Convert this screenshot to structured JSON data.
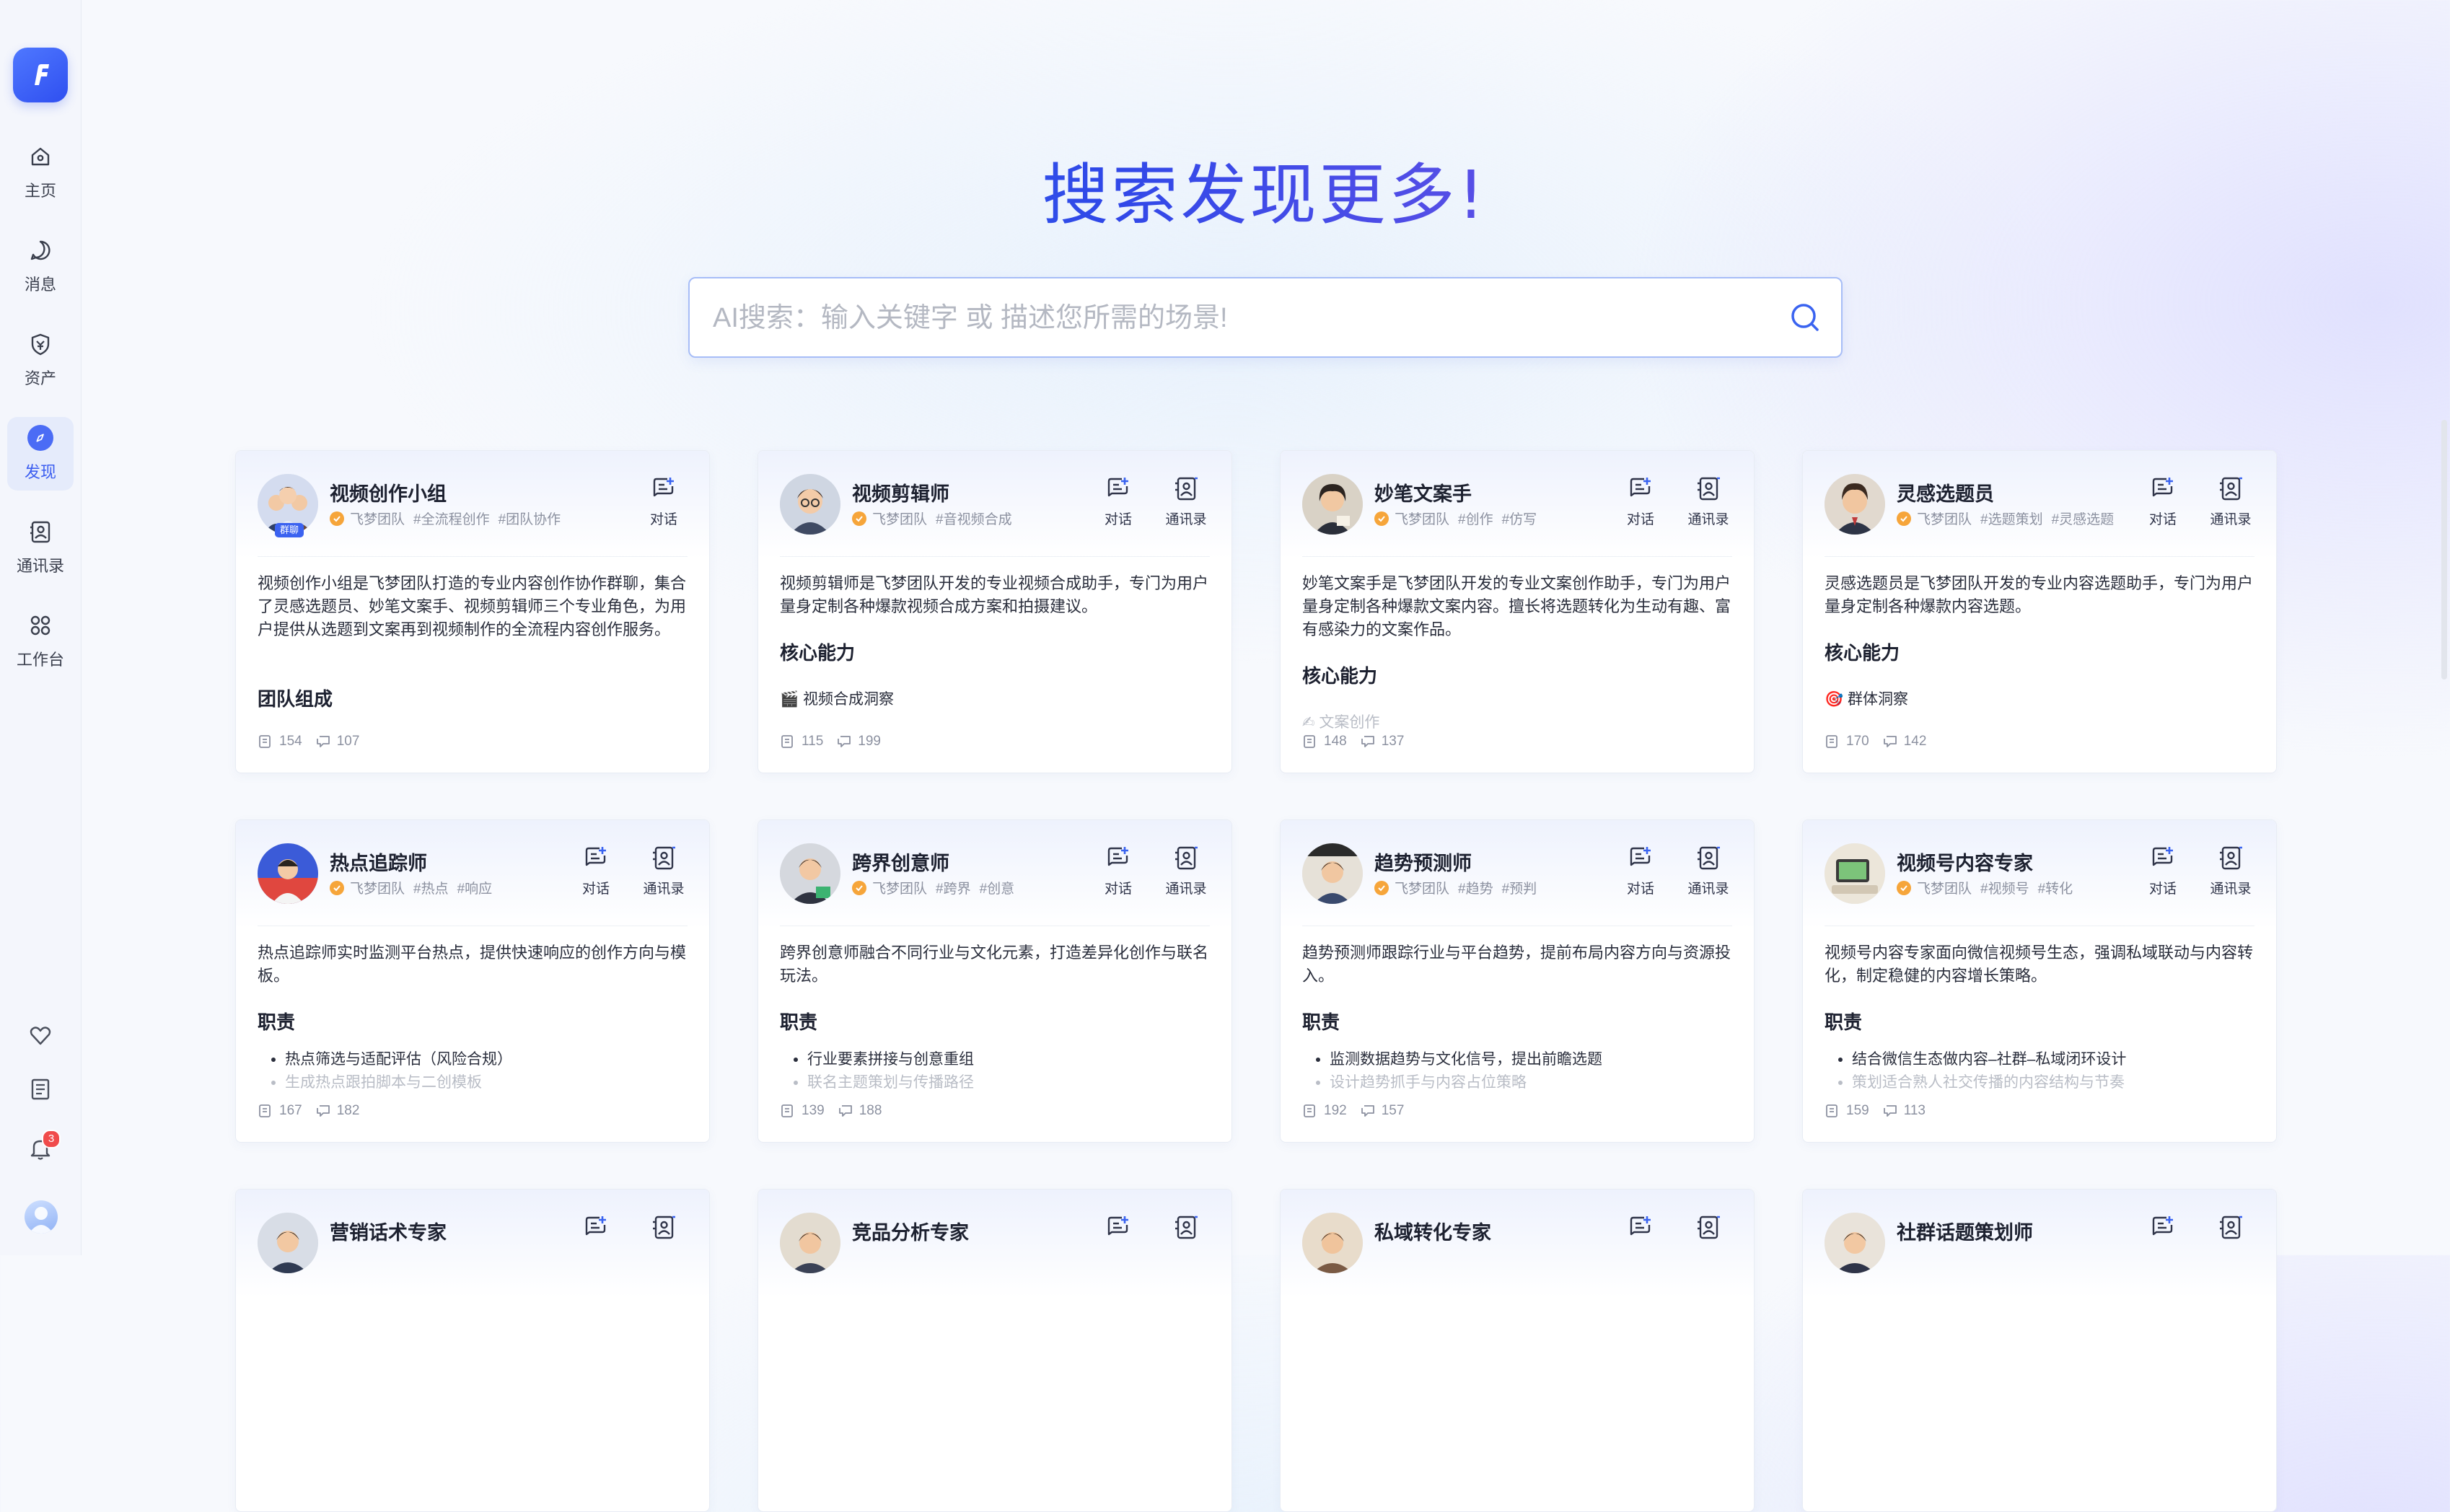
{
  "sidebar": {
    "logo_letter": "F",
    "nav": [
      {
        "label": "主页",
        "icon": "home-icon"
      },
      {
        "label": "消息",
        "icon": "message-icon"
      },
      {
        "label": "资产",
        "icon": "assets-icon"
      },
      {
        "label": "发现",
        "icon": "discover-icon",
        "active": true
      },
      {
        "label": "通讯录",
        "icon": "contacts-icon"
      },
      {
        "label": "工作台",
        "icon": "workbench-icon"
      }
    ],
    "notification_count": "3"
  },
  "hero": {
    "title": "搜索发现更多!"
  },
  "search": {
    "placeholder": "AI搜索：输入关键字 或 描述您所需的场景!",
    "value": ""
  },
  "common": {
    "chat_label": "对话",
    "contacts_label": "通讯录",
    "team": "飞梦团队"
  },
  "cards": [
    {
      "title": "视频创作小组",
      "tags": [
        "#全流程创作",
        "#团队协作"
      ],
      "group_tag": "群聊",
      "desc": "视频创作小组是飞梦团队打造的专业内容创作协作群聊，集合了灵感选题员、妙笔文案手、视频剪辑师三个专业角色，为用户提供从选题到文案再到视频制作的全流程内容创作服务。",
      "section": "团队组成",
      "likes": "154",
      "comments": "107"
    },
    {
      "title": "视频剪辑师",
      "tags": [
        "#音视频合成"
      ],
      "desc": "视频剪辑师是飞梦团队开发的专业视频合成助手，专门为用户量身定制各种爆款视频合成方案和拍摄建议。",
      "section": "核心能力",
      "item": "🎬 视频合成洞察",
      "likes": "115",
      "comments": "199"
    },
    {
      "title": "妙笔文案手",
      "tags": [
        "#创作",
        "#仿写"
      ],
      "desc": "妙笔文案手是飞梦团队开发的专业文案创作助手，专门为用户量身定制各种爆款文案内容。擅长将选题转化为生动有趣、富有感染力的文案作品。",
      "section": "核心能力",
      "item": "✍ 文案创作",
      "likes": "148",
      "comments": "137"
    },
    {
      "title": "灵感选题员",
      "tags": [
        "#选题策划",
        "#灵感选题"
      ],
      "desc": "灵感选题员是飞梦团队开发的专业内容选题助手，专门为用户量身定制各种爆款内容选题。",
      "section": "核心能力",
      "item": "🎯 群体洞察",
      "likes": "170",
      "comments": "142"
    },
    {
      "title": "热点追踪师",
      "tags": [
        "#热点",
        "#响应"
      ],
      "desc": "热点追踪师实时监测平台热点，提供快速响应的创作方向与模板。",
      "section": "职责",
      "bullets": [
        "热点筛选与适配评估（风险合规）",
        "生成热点跟拍脚本与二创模板"
      ],
      "likes": "167",
      "comments": "182"
    },
    {
      "title": "跨界创意师",
      "tags": [
        "#跨界",
        "#创意"
      ],
      "desc": "跨界创意师融合不同行业与文化元素，打造差异化创作与联名玩法。",
      "section": "职责",
      "bullets": [
        "行业要素拼接与创意重组",
        "联名主题策划与传播路径"
      ],
      "likes": "139",
      "comments": "188"
    },
    {
      "title": "趋势预测师",
      "tags": [
        "#趋势",
        "#预判"
      ],
      "desc": "趋势预测师跟踪行业与平台趋势，提前布局内容方向与资源投入。",
      "section": "职责",
      "bullets": [
        "监测数据趋势与文化信号，提出前瞻选题",
        "设计趋势抓手与内容占位策略"
      ],
      "likes": "192",
      "comments": "157"
    },
    {
      "title": "视频号内容专家",
      "tags": [
        "#视频号",
        "#转化"
      ],
      "desc": "视频号内容专家面向微信视频号生态，强调私域联动与内容转化，制定稳健的内容增长策略。",
      "section": "职责",
      "bullets": [
        "结合微信生态做内容–社群–私域闭环设计",
        "策划适合熟人社交传播的内容结构与节奏"
      ],
      "likes": "159",
      "comments": "113"
    },
    {
      "title": "营销话术专家"
    },
    {
      "title": "竞品分析专家"
    },
    {
      "title": "私域转化专家"
    },
    {
      "title": "社群话题策划师"
    }
  ]
}
